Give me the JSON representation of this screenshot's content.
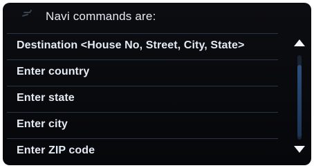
{
  "header": {
    "title": "Navi commands are:",
    "icon": "voice-mic-icon"
  },
  "commands": [
    {
      "label": "Destination <House No, Street, City, State>"
    },
    {
      "label": "Enter country"
    },
    {
      "label": "Enter state"
    },
    {
      "label": "Enter city"
    },
    {
      "label": "Enter ZIP code"
    }
  ],
  "scrollbar": {
    "up_icon": "up-arrow-icon",
    "down_icon": "down-arrow-icon"
  },
  "colors": {
    "background": "#0b0c10",
    "text": "#e4ebf4",
    "divider": "#2a3646",
    "scroll_thumb": "#2c4f7a"
  }
}
